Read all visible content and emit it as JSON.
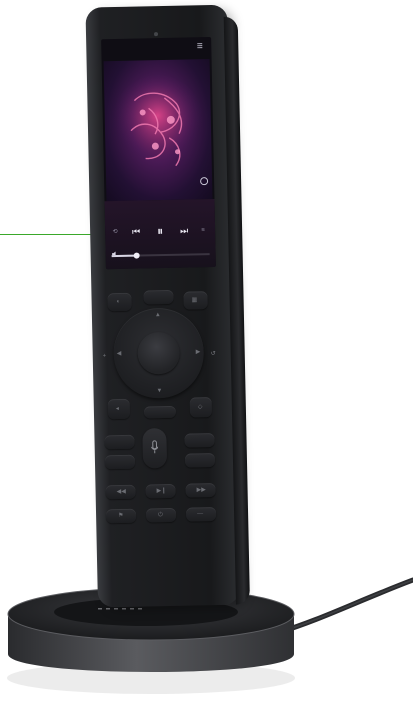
{
  "colors": {
    "background": "#ffffff",
    "callout_line": "#3aa82a",
    "remote_body": "#1c1d20",
    "dock_top": "#2a2b2e",
    "dock_side": "#4a4b4e",
    "cable": "#2a2b2e"
  },
  "screen": {
    "status_time": "",
    "header_title": "",
    "track_title": "",
    "track_artist": "",
    "progress": 0.25
  },
  "icons": {
    "play_pause": "pause-icon",
    "previous": "previous-icon",
    "next": "next-icon",
    "microphone": "microphone-icon",
    "info": "info-icon",
    "menu": "menu-icon"
  }
}
